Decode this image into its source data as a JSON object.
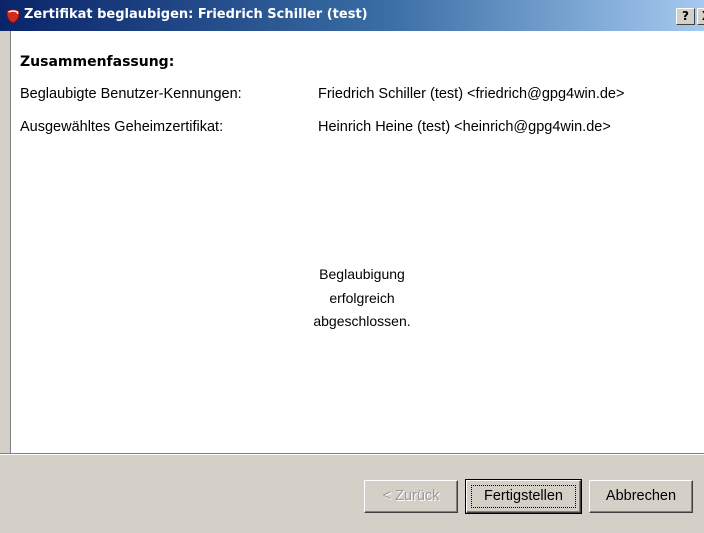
{
  "window": {
    "title": "Zertifikat beglaubigen: Friedrich Schiller (test)",
    "help_label": "?",
    "close_label": "X"
  },
  "summary": {
    "heading": "Zusammenfassung:",
    "rows": [
      {
        "label": "Beglaubigte Benutzer-Kennungen:",
        "value": "Friedrich Schiller (test) <friedrich@gpg4win.de>"
      },
      {
        "label": "Ausgewähltes Geheimzertifikat:",
        "value": "Heinrich Heine (test) <heinrich@gpg4win.de>"
      }
    ]
  },
  "status": {
    "lines": [
      "Beglaubigung",
      "erfolgreich",
      "abgeschlossen."
    ]
  },
  "buttons": {
    "back": "< Zurück",
    "finish": "Fertigstellen",
    "cancel": "Abbrechen"
  },
  "colors": {
    "title_gradient_start": "#0a246a",
    "title_gradient_end": "#a6caf0",
    "dialog_bg": "#d4d0c8",
    "content_bg": "#ffffff",
    "icon_red": "#d12a1f"
  },
  "icons": {
    "app": "kleopatra-certificate-icon"
  }
}
